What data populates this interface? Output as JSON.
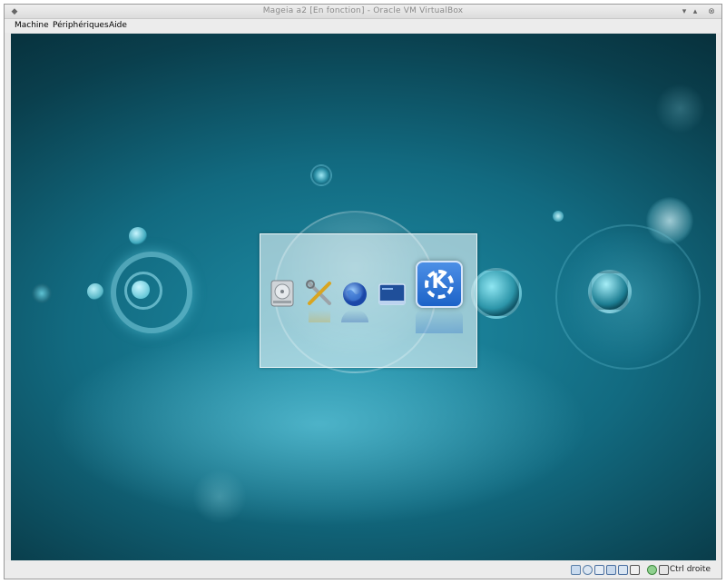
{
  "window": {
    "title": "Mageia a2 [En fonction] - Oracle VM VirtualBox"
  },
  "titlebar_buttons": [
    {
      "name": "window-menu-icon",
      "glyph": "◆"
    },
    {
      "name": "minimize-icon",
      "glyph": "▾"
    },
    {
      "name": "maximize-icon",
      "glyph": "▴"
    },
    {
      "name": "close-icon",
      "glyph": "⊗"
    }
  ],
  "menubar": {
    "items": [
      "Machine",
      "Périphériques",
      "Aide"
    ]
  },
  "guest": {
    "splash_icons": [
      "hard-disk-icon",
      "tools-icon",
      "globe-icon",
      "desktop-icon",
      "kde-logo-icon"
    ],
    "kde_logo_letter": "K",
    "colors": {
      "background_dark": "#0a3f4d",
      "background_mid": "#1f8fa8",
      "kde_blue": "#1d63c8"
    }
  },
  "statusbar": {
    "indicators": [
      "hard-disk-activity-icon",
      "optical-drive-icon",
      "usb-icon",
      "shared-folders-icon",
      "network-icon",
      "display-icon",
      "virtualization-icon",
      "mouse-integration-icon"
    ],
    "host_key": "Ctrl droite"
  }
}
